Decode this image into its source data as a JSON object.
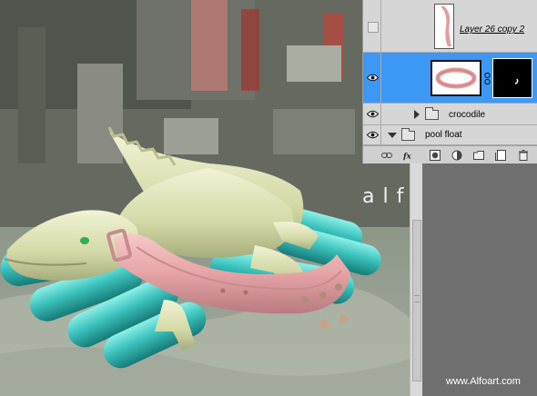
{
  "layers_panel": {
    "layers": [
      {
        "name": "Layer 26 copy 2",
        "visible": false,
        "selected": false,
        "type": "layer"
      },
      {
        "name": "",
        "visible": true,
        "selected": true,
        "type": "layer-with-mask"
      },
      {
        "name": "crocodile",
        "visible": true,
        "selected": false,
        "type": "group",
        "expanded": false
      },
      {
        "name": "pool float",
        "visible": true,
        "selected": false,
        "type": "group",
        "expanded": true
      }
    ],
    "footer_icons": [
      "link-icon",
      "fx-icon",
      "mask-icon",
      "adjustment-icon",
      "new-group-icon",
      "new-layer-icon",
      "trash-icon"
    ]
  },
  "canvas": {
    "watermark_partial": "alf"
  },
  "credit": "www.Alfoart.com",
  "colors": {
    "selection_blue": "#3d98f5",
    "panel_bg": "#d6d6d6",
    "float_teal": "#3cc2bd",
    "collar_pink": "#e6a3a6",
    "croc_cream": "#d8ddb0"
  }
}
